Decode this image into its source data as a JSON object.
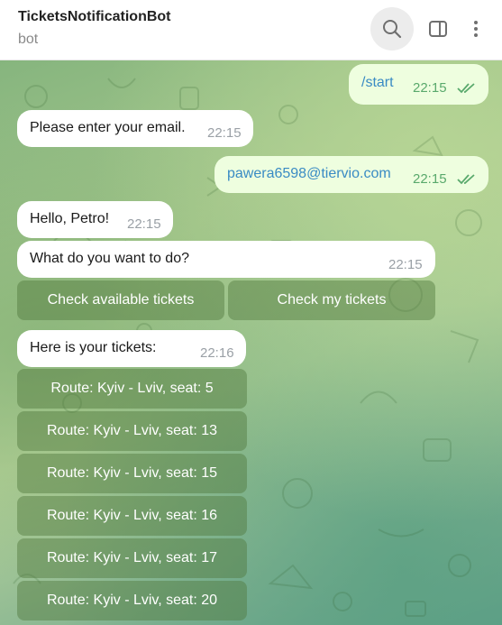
{
  "header": {
    "title": "TicketsNotificationBot",
    "subtitle": "bot"
  },
  "messages": [
    {
      "text": "/start",
      "time": "22:15",
      "outgoing": true
    },
    {
      "text": "Please enter your email.",
      "time": "22:15"
    },
    {
      "text": "pawera6598@tiervio.com",
      "time": "22:15",
      "outgoing": true
    },
    {
      "text": "Hello, Petro!",
      "time": "22:15"
    },
    {
      "text": "What do you want to do?",
      "time": "22:15"
    },
    {
      "text": "Here is your tickets:",
      "time": "22:16"
    }
  ],
  "keyboard_main": [
    "Check available tickets",
    "Check my tickets"
  ],
  "tickets": [
    "Route: Kyiv - Lviv, seat: 5",
    "Route: Kyiv - Lviv, seat: 13",
    "Route: Kyiv - Lviv, seat: 15",
    "Route: Kyiv - Lviv, seat: 16",
    "Route: Kyiv - Lviv, seat: 17",
    "Route: Kyiv - Lviv, seat: 20"
  ],
  "colors": {
    "outgoing_bubble": "#eefedf",
    "incoming_bubble": "#ffffff",
    "link_blue": "#3a8bc4",
    "check_green": "#59a96c"
  }
}
